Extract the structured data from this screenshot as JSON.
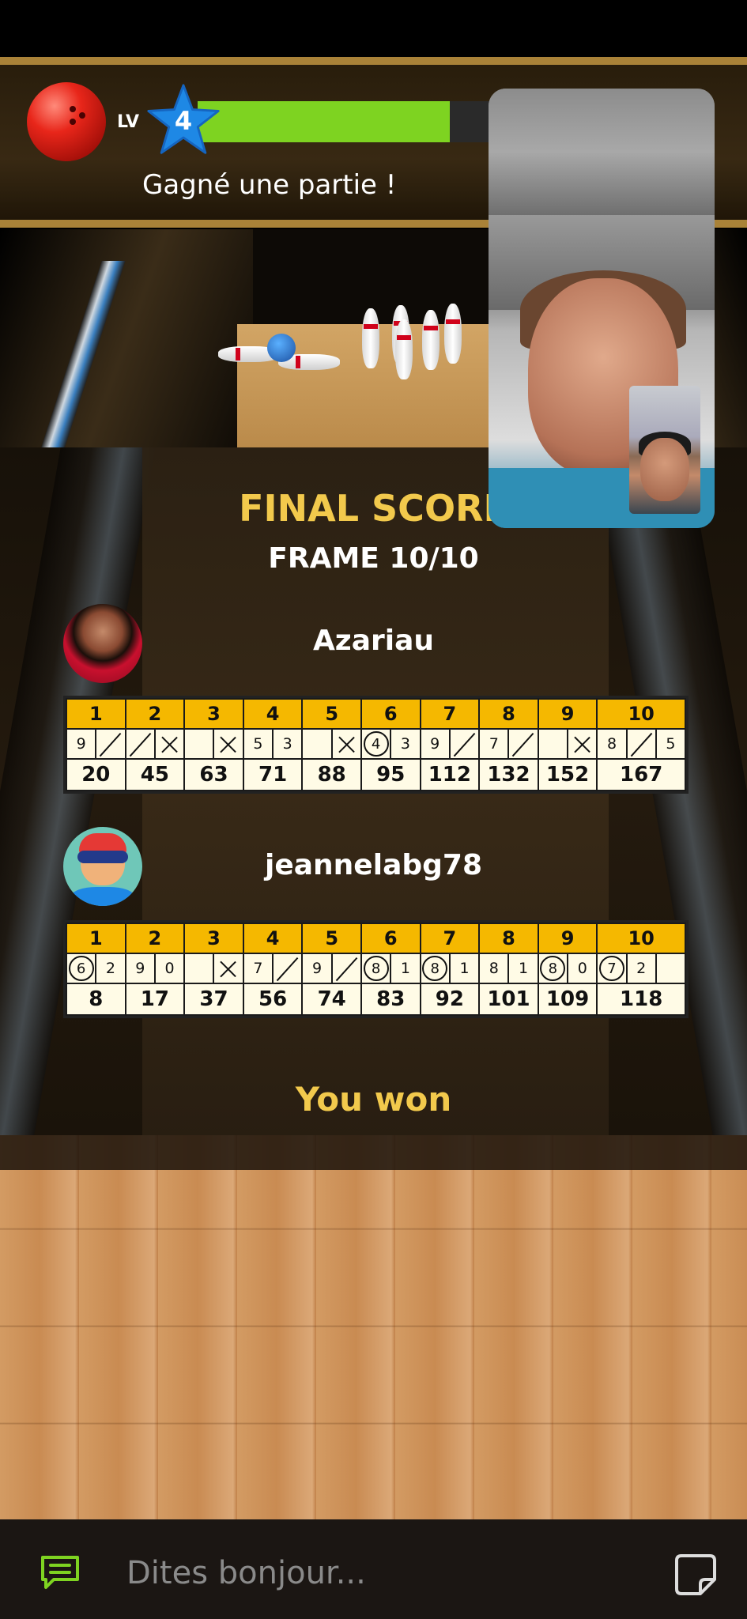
{
  "level": {
    "label": "LV",
    "number": "4",
    "progress_fraction": 0.84
  },
  "notification": "Gagné une partie !",
  "final": {
    "title": "FINAL SCORE",
    "frame": "FRAME 10/10"
  },
  "players": [
    {
      "name": "Azariau",
      "frames": [
        "1",
        "2",
        "3",
        "4",
        "5",
        "6",
        "7",
        "8",
        "9",
        "10"
      ],
      "rolls": [
        [
          "9",
          "/"
        ],
        [
          "/",
          "X"
        ],
        [
          "",
          "X"
        ],
        [
          "5",
          "3"
        ],
        [
          "",
          "X"
        ],
        [
          "(4)",
          "3"
        ],
        [
          "9",
          "/"
        ],
        [
          "7",
          "/"
        ],
        [
          "",
          "X"
        ],
        [
          "8",
          "/",
          "5"
        ]
      ],
      "totals": [
        "20",
        "45",
        "63",
        "71",
        "88",
        "95",
        "112",
        "132",
        "152",
        "167"
      ]
    },
    {
      "name": "jeannelabg78",
      "frames": [
        "1",
        "2",
        "3",
        "4",
        "5",
        "6",
        "7",
        "8",
        "9",
        "10"
      ],
      "rolls": [
        [
          "(6)",
          "2"
        ],
        [
          "9",
          "0"
        ],
        [
          "",
          "X"
        ],
        [
          "7",
          "/"
        ],
        [
          "9",
          "/"
        ],
        [
          "(8)",
          "1"
        ],
        [
          "(8)",
          "1"
        ],
        [
          "8",
          "1"
        ],
        [
          "(8)",
          "0"
        ],
        [
          "(7)",
          "2",
          ""
        ]
      ],
      "totals": [
        "8",
        "17",
        "37",
        "56",
        "74",
        "83",
        "92",
        "101",
        "109",
        "118"
      ]
    }
  ],
  "result": "You won",
  "chat": {
    "placeholder": "Dites bonjour..."
  },
  "colors": {
    "accent_gold": "#f2c94c",
    "xp_green": "#7ed321",
    "star_blue": "#1e88e5",
    "score_header": "#f5b800"
  },
  "icons": [
    "bowling-ball-icon",
    "level-star-icon",
    "chat-icon",
    "sticker-icon"
  ]
}
